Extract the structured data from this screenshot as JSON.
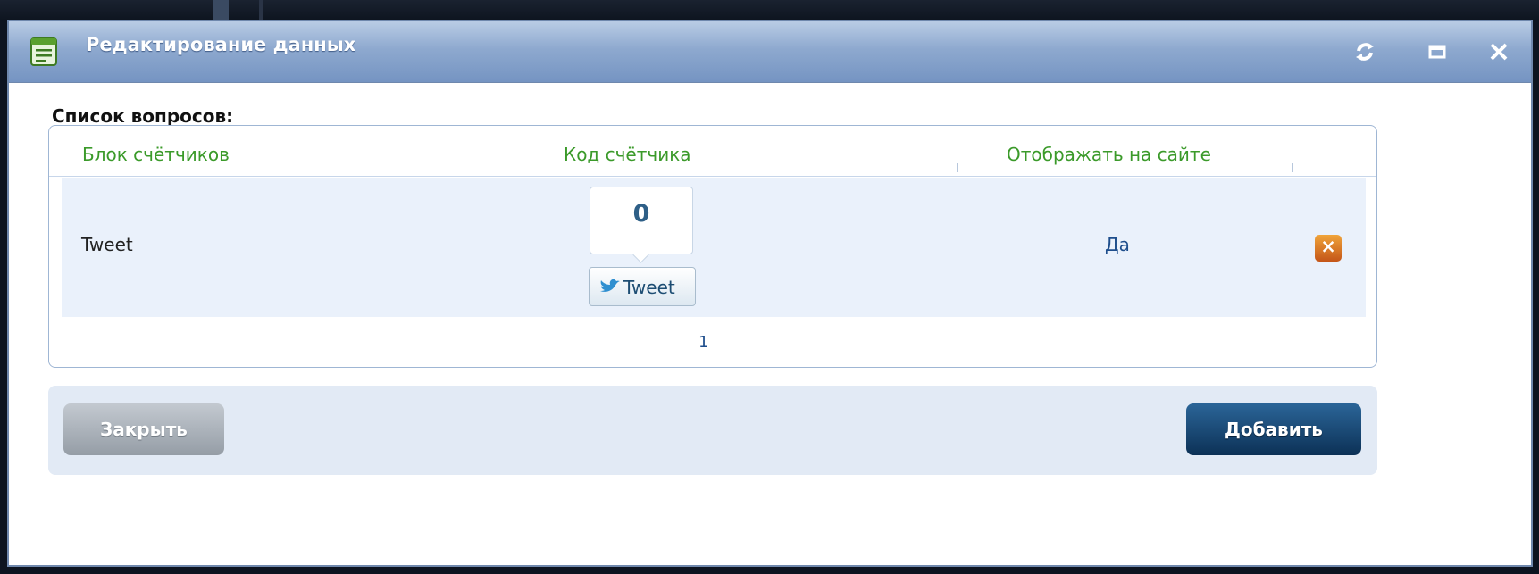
{
  "window": {
    "title": "Редактирование данных",
    "controls": {
      "refresh_icon": "refresh-icon",
      "maximize_icon": "maximize-icon",
      "close_icon": "close-icon"
    }
  },
  "questions": {
    "label": "Список вопросов:",
    "columns": [
      "Блок счётчиков",
      "Код счётчика",
      "Отображать на сайте"
    ],
    "rows": [
      {
        "name": "Tweet",
        "counter": {
          "count": "0",
          "button_label": "Tweet",
          "icon": "twitter-bird-icon"
        },
        "display": "Да",
        "delete_icon": "delete-icon"
      }
    ],
    "pagination": {
      "current_page": "1"
    }
  },
  "footer": {
    "close_label": "Закрыть",
    "add_label": "Добавить"
  },
  "colors": {
    "titlebar": "#8ea9cf",
    "header_text": "#3b9a2a",
    "link": "#1e4e8c",
    "primary_button": "#0c3156",
    "secondary_button": "#959da6",
    "delete_button": "#c45518"
  }
}
